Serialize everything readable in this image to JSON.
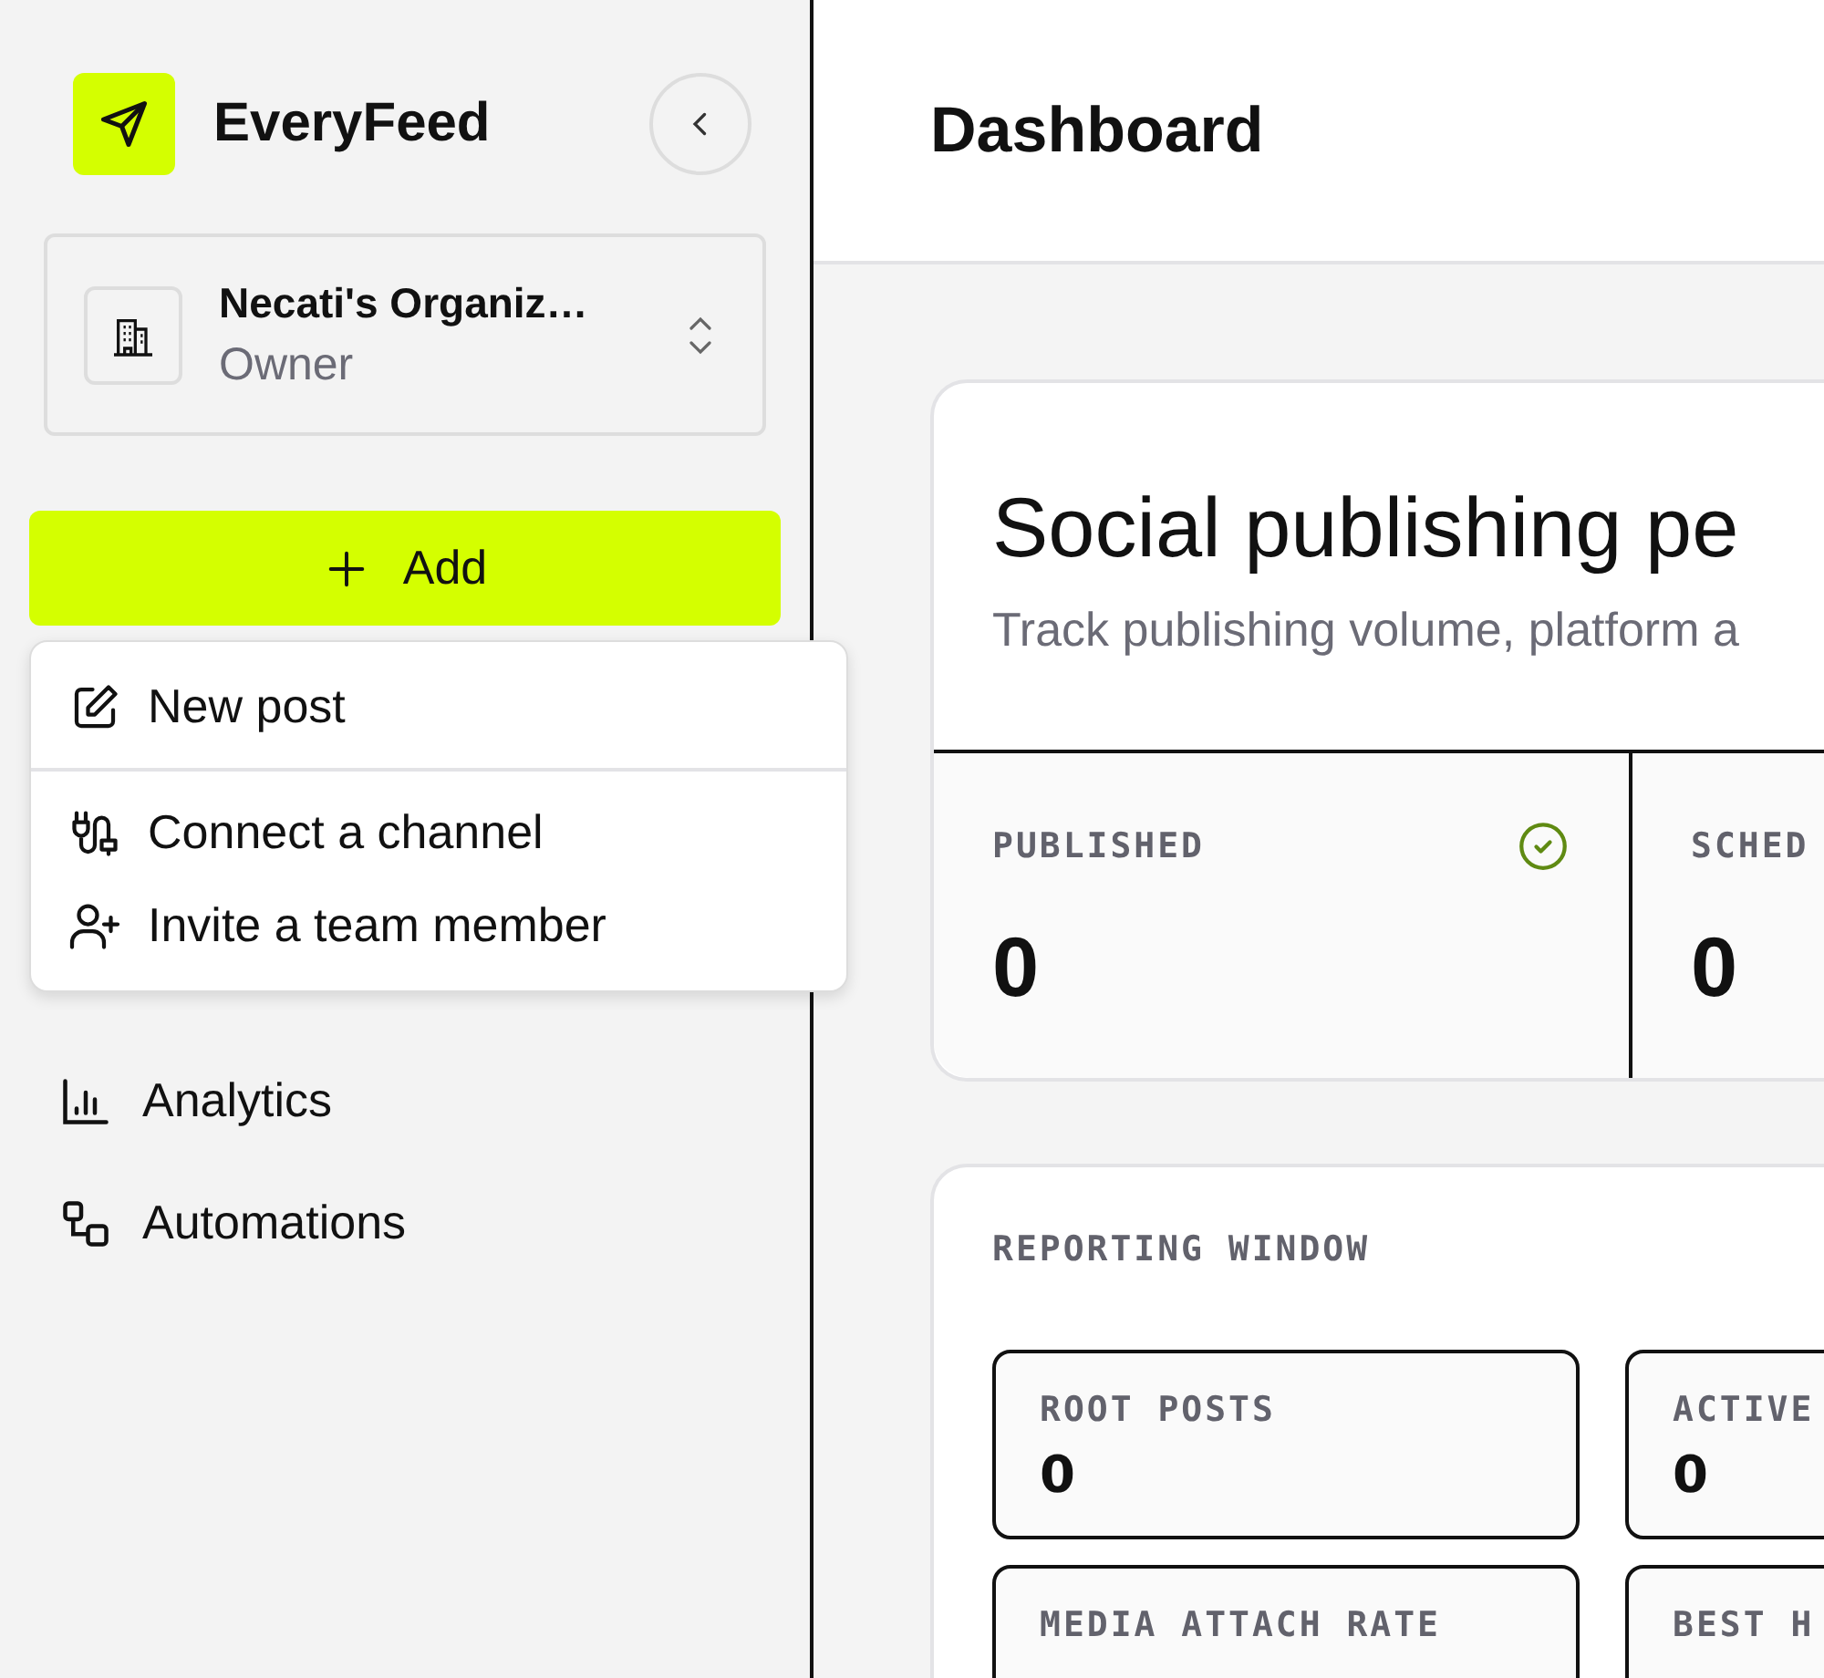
{
  "sidebar": {
    "brand": "EveryFeed",
    "organization": {
      "name": "Necati's Organiz…",
      "role": "Owner"
    },
    "add_button": {
      "label": "Add"
    },
    "add_menu": [
      {
        "items": [
          {
            "label": "New post",
            "kind": "edit"
          }
        ]
      },
      {
        "items": [
          {
            "label": "Connect a channel",
            "kind": "plug"
          },
          {
            "label": "Invite a team member",
            "kind": "invite"
          }
        ]
      }
    ],
    "nav": [
      {
        "label": "Analytics",
        "kind": "chart"
      },
      {
        "label": "Automations",
        "kind": "flow"
      }
    ]
  },
  "header": {
    "title": "Dashboard"
  },
  "overview": {
    "title": "Social publishing pe",
    "subtitle": "Track publishing volume, platform a",
    "stats": [
      {
        "label": "PUBLISHED",
        "value": "0",
        "kind": "verified"
      },
      {
        "label": "SCHED",
        "value": "0",
        "kind": "plain"
      }
    ]
  },
  "reporting": {
    "title": "REPORTING WINDOW",
    "tiles": [
      {
        "label": "ROOT POSTS",
        "value": "0"
      },
      {
        "label": "ACTIVE",
        "value": "0"
      },
      {
        "label": "MEDIA ATTACH RATE"
      },
      {
        "label": "BEST H"
      }
    ]
  }
}
